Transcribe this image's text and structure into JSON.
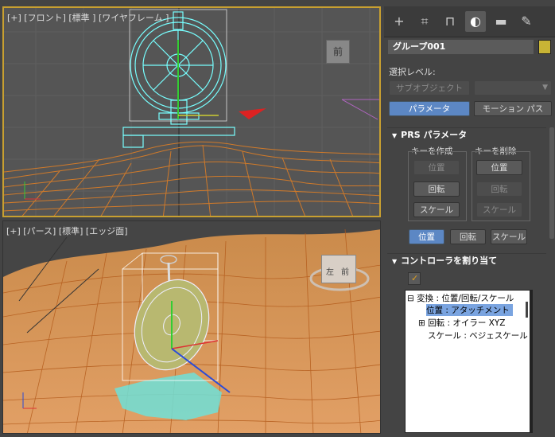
{
  "viewports": {
    "front": {
      "label": "[+] [フロント] [標準 ] [ワイヤフレーム ]",
      "viewcube_label": "前"
    },
    "perspective": {
      "label": "[+] [パース] [標準] [エッジ面]",
      "viewcube_labels": [
        "左",
        "前"
      ]
    }
  },
  "panel": {
    "tabs": [
      {
        "icon": "plus-icon",
        "glyph": "+"
      },
      {
        "icon": "modify-icon",
        "glyph": "⌗"
      },
      {
        "icon": "hierarchy-icon",
        "glyph": "⊓"
      },
      {
        "icon": "motion-icon",
        "glyph": "◐"
      },
      {
        "icon": "display-icon",
        "glyph": "▬"
      },
      {
        "icon": "utilities-icon",
        "glyph": "✎"
      }
    ],
    "object_name": "グループ001",
    "object_color": "#c8b435",
    "selection_level_label": "選択レベル:",
    "subobject_button": "サブオブジェクト",
    "parameters_button": "パラメータ",
    "motion_paths_button": "モーション パス",
    "prs": {
      "title": "PRS パラメータ",
      "create_key_label": "キーを作成",
      "delete_key_label": "キーを削除",
      "create_keys": [
        "位置",
        "回転",
        "スケール"
      ],
      "delete_keys": [
        "位置",
        "回転",
        "スケール"
      ],
      "modes": [
        "位置",
        "回転",
        "スケール"
      ]
    },
    "controller": {
      "title": "コントローラを割り当て",
      "tree": [
        {
          "text": "⊟ 変換 : 位置/回転/スケール"
        },
        {
          "text": "位置 : アタッチメント"
        },
        {
          "text": "⊞ 回転 : オイラー XYZ"
        },
        {
          "text": "スケール : ベジェスケール"
        }
      ]
    }
  }
}
